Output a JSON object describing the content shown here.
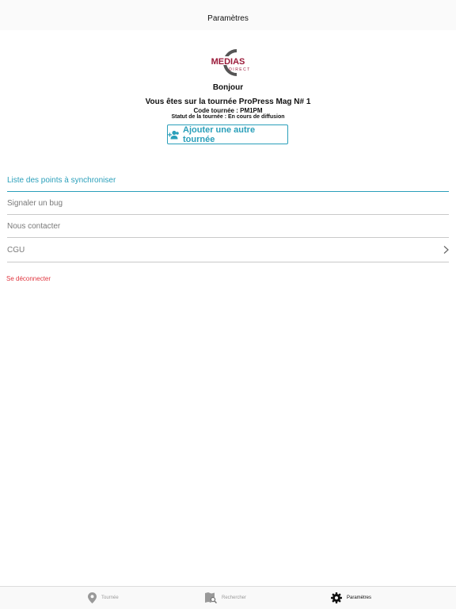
{
  "header": {
    "title": "Paramètres"
  },
  "logo": {
    "name": "medias-direct-logo",
    "text_main": "MEDIAS",
    "text_sub": "DIRECT",
    "color": "#9b1b3a"
  },
  "profile": {
    "greeting": "Bonjour",
    "tour_line": "Vous êtes sur la tournée ProPress Mag N# 1",
    "code_line": "Code tournée : PM1PM",
    "status_line": "Statut de la tournée : En cours de diffusion"
  },
  "add_button": {
    "label": "Ajouter une autre tournée",
    "icon": "add-group-icon"
  },
  "menu": {
    "items": [
      {
        "label": "Liste des points à synchroniser",
        "active": true
      },
      {
        "label": "Signaler un bug"
      },
      {
        "label": "Nous contacter"
      },
      {
        "label": "CGU",
        "has_chevron": true
      }
    ]
  },
  "logout": {
    "label": "Se déconnecter",
    "color": "#e0363f"
  },
  "tabbar": {
    "tabs": [
      {
        "label": "Tournée",
        "icon": "map-pin-icon"
      },
      {
        "label": "Rechercher",
        "icon": "map-search-icon"
      },
      {
        "label": "Paramètres",
        "icon": "gear-icon",
        "active": true
      }
    ]
  },
  "colors": {
    "accent": "#2a9fba",
    "danger": "#e0363f",
    "divider": "#c9c9c9"
  }
}
